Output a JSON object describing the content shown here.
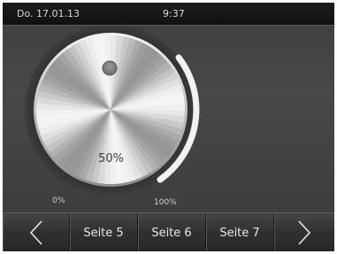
{
  "status_bar": {
    "date": "Do. 17.01.13",
    "time": "9:37"
  },
  "dial": {
    "value_label": "50%",
    "min_label": "0%",
    "max_label": "100%",
    "value": 0.5
  },
  "nav": {
    "prev_icon": "chevron-left-icon",
    "pages": [
      {
        "label": "Seite 5"
      },
      {
        "label": "Seite 6"
      },
      {
        "label": "Seite 7"
      }
    ],
    "next_icon": "chevron-right-icon"
  },
  "colors": {
    "screen_bg": "#404040",
    "status_bar": "#141414",
    "text": "#e0e0e0"
  }
}
